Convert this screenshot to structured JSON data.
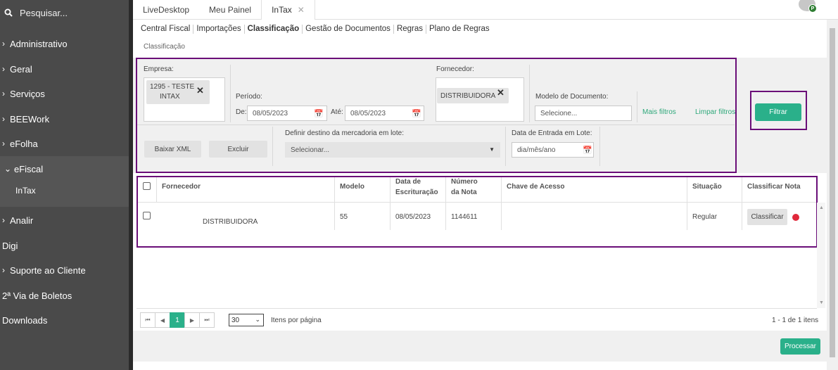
{
  "sidebar": {
    "search_placeholder": "Pesquisar...",
    "items": [
      {
        "label": "Administrativo"
      },
      {
        "label": "Geral"
      },
      {
        "label": "Serviços"
      },
      {
        "label": "BEEWork"
      },
      {
        "label": "eFolha"
      },
      {
        "label": "eFiscal"
      },
      {
        "label": "Analir"
      },
      {
        "label": "Digi"
      },
      {
        "label": "Suporte ao Cliente"
      },
      {
        "label": "2ª Via de Boletos"
      },
      {
        "label": "Downloads"
      }
    ],
    "sub_item": "InTax"
  },
  "tabs": [
    {
      "label": "LiveDesktop"
    },
    {
      "label": "Meu Painel"
    },
    {
      "label": "InTax"
    }
  ],
  "avatar_badge": "P",
  "subtabs": [
    "Central Fiscal",
    "Importações",
    "Classificação",
    "Gestão de Documentos",
    "Regras",
    "Plano de Regras"
  ],
  "breadcrumb": "Classificação",
  "filters": {
    "empresa_label": "Empresa:",
    "empresa_chip_line1": "1295 - TESTE",
    "empresa_chip_line2": "INTAX",
    "periodo_label": "Período:",
    "de_label": "De:",
    "de_value": "08/05/2023",
    "ate_label": "Até:",
    "ate_value": "08/05/2023",
    "fornecedor_label": "Fornecedor:",
    "fornecedor_chip": "DISTRIBUIDORA",
    "modelo_label": "Modelo de Documento:",
    "modelo_placeholder": "Selecione...",
    "mais_filtros": "Mais filtros",
    "limpar_filtros": "Limpar filtros",
    "filtrar": "Filtrar",
    "baixar_xml": "Baixar XML",
    "excluir": "Excluir",
    "destino_label": "Definir destino da mercadoria em lote:",
    "destino_value": "Selecionar...",
    "data_entrada_label": "Data de Entrada em Lote:",
    "data_entrada_placeholder": "dia/mês/ano"
  },
  "table": {
    "headers": {
      "fornecedor": "Fornecedor",
      "modelo": "Modelo",
      "data_escrituracao_1": "Data de",
      "data_escrituracao_2": "Escrituração",
      "numero_nota_1": "Número",
      "numero_nota_2": "da Nota",
      "chave": "Chave de Acesso",
      "situacao": "Situação",
      "classificar": "Classificar Nota"
    },
    "rows": [
      {
        "fornecedor": "DISTRIBUIDORA",
        "modelo": "55",
        "data": "08/05/2023",
        "numero": "1144611",
        "chave": "",
        "situacao": "Regular",
        "acao": "Classificar"
      }
    ]
  },
  "pager": {
    "current_page": "1",
    "per_page": "30",
    "per_page_label": "Itens por página",
    "summary": "1 - 1 de 1 itens"
  },
  "processar": "Processar",
  "colors": {
    "sidebar_bg": "#4a4a4a",
    "accent_green": "#2ab08a",
    "highlight_purple": "#6a0e78",
    "status_red": "#e0283b"
  }
}
